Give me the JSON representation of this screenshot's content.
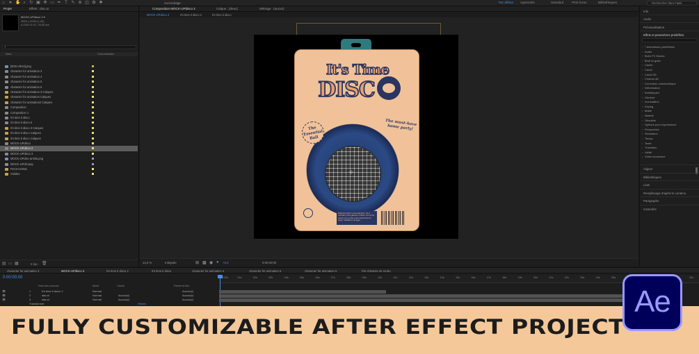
{
  "topbar": {
    "snap_label": "Accrochage",
    "workspaces": [
      "Par défaut",
      "Apprendre",
      "Standard",
      "Petit écran",
      "Bibliothèques"
    ],
    "active_workspace": "Par défaut",
    "search_placeholder": "Rechercher dans l'aide"
  },
  "project": {
    "tabs": [
      "Projet",
      "Effets : disc.ai"
    ],
    "selected_name": "MOCK-UPdisco 2 ▾",
    "info_lines": [
      "2000 x 2000 (1,00)",
      "Δ 0:00:11:01, 25,00 ips"
    ],
    "search_placeholder": "",
    "col_name": "Nom",
    "col_comment": "Commentaire",
    "items": [
      {
        "label": "[0001-0010].png",
        "type": "img",
        "color": "#c9b44a"
      },
      {
        "label": "character for animation 3",
        "type": "comp",
        "color": "#e8e07a"
      },
      {
        "label": "character for animation 4",
        "type": "comp",
        "color": "#e8e07a"
      },
      {
        "label": "character for animation 5",
        "type": "comp",
        "color": "#e8e07a"
      },
      {
        "label": "character for animation 6",
        "type": "comp",
        "color": "#e8e07a"
      },
      {
        "label": "character for animation 3 Calques",
        "type": "folder",
        "color": "#e8e07a"
      },
      {
        "label": "character for animation Calques",
        "type": "folder",
        "color": "#e8e07a"
      },
      {
        "label": "character for animation2 Calques",
        "type": "folder",
        "color": "#e8e07a"
      },
      {
        "label": "Composition",
        "type": "comp",
        "color": "#e8e07a"
      },
      {
        "label": "Composition 1",
        "type": "comp",
        "color": "#e8e07a"
      },
      {
        "label": "it's time ti disco",
        "type": "comp",
        "color": "#e8e07a"
      },
      {
        "label": "it's time ti disco-2",
        "type": "comp",
        "color": "#e8e07a"
      },
      {
        "label": "it's time ti disco 3 Calques",
        "type": "folder",
        "color": "#e8e07a"
      },
      {
        "label": "it's time ti disco Calques",
        "type": "folder",
        "color": "#e8e07a"
      },
      {
        "label": "it's time ti disco Calques",
        "type": "folder",
        "color": "#e8e07a"
      },
      {
        "label": "MOCK-UPdisco",
        "type": "comp",
        "color": "#e8e07a"
      },
      {
        "label": "MOCK-UPdisco 2",
        "type": "comp",
        "color": "#e8e07a",
        "selected": true
      },
      {
        "label": "MOCK-UPdisco 3",
        "type": "comp",
        "color": "#e8e07a"
      },
      {
        "label": "MOCK-UPdisc-armila.png",
        "type": "img",
        "color": "#8f9ad8"
      },
      {
        "label": "MOCK-UPdsl.png",
        "type": "img",
        "color": "#8f9ad8"
      },
      {
        "label": "PACKAGING",
        "type": "folder",
        "color": "#e8e07a"
      },
      {
        "label": "Solides",
        "type": "folder",
        "color": "#e8e07a"
      }
    ],
    "footer_label": "8 bpc"
  },
  "composition": {
    "tabs": [
      "Composition MOCK-UPdisco 2",
      "Calque : (deux)",
      "Métrage : (aucun)"
    ],
    "breadcrumb": [
      "MOCK-UPdisco 3",
      "it's time ti disco 2",
      "it's time ti disco"
    ],
    "zoom": "12,5 %",
    "resolution": "Intégrale",
    "exposure": "+0,0",
    "timecode": "0:00:00:00"
  },
  "artwork": {
    "title1": "It's Time",
    "title2": "DISC",
    "badge": "The Essential Ball",
    "tagline": "The must-have home party!",
    "info_text": "Reflective light in every direction. It's a reminder of the glamour of disco. Put on the record, turn up the music and let the fun begin. Suitable for all ages."
  },
  "right_panel": {
    "sections_top": [
      "Info",
      "Audio",
      "Prévisualisation"
    ],
    "effects_header": "Effets et paramètres prédéfinis",
    "effects_search": "",
    "effects": [
      "* Animations prédéfinies",
      "Audio",
      "Boris FX Mocha",
      "Bruit et grain",
      "Cache",
      "Canal",
      "Canal 3D",
      "Cinema 4D",
      "Correction colorimétrique",
      "Déformation",
      "Esthétiques",
      "Générer",
      "Incrustation",
      "Keying",
      "Matte",
      "Netteté",
      "Obsolète",
      "Options pour expressions",
      "Perspective",
      "Simulation",
      "Temps",
      "Texte",
      "Transition",
      "Utilité",
      "Vidéo immersive"
    ],
    "sections_bottom": [
      "Aligner",
      "Bibliothèques",
      "Liam",
      "Remplissage d'après le contenu",
      "Paragraphe",
      "Caractère"
    ]
  },
  "timeline": {
    "tabs": [
      "character for animation 3",
      "MOCK-UPdisco 3",
      "it's time ti disco 2",
      "it's time ti disco",
      "character for animation 4",
      "character for animation 5",
      "character for animation 6",
      "File d'attente de rendu"
    ],
    "active_tab": "MOCK-UPdisco 3",
    "timecode": "0:00:00:00",
    "ticks": [
      "0:00s",
      "01s",
      "02s",
      "03s",
      "04s",
      "05s",
      "06s",
      "07s",
      "08s",
      "09s",
      "10s",
      "11s",
      "12s",
      "13s",
      "14s",
      "15s",
      "16s",
      "17s",
      "18s",
      "19s",
      "20s",
      "21s",
      "22s",
      "23s",
      "24s",
      "25s",
      "26s",
      "27s",
      "28s",
      "29s",
      "30s"
    ],
    "headers": {
      "name": "Nom des sources",
      "mode": "Mode",
      "cache": "Cache",
      "parent": "Parent et lien"
    },
    "layers": [
      {
        "num": "1",
        "name": "It's time ti disco 2",
        "mode": "Normal",
        "cache": "",
        "parent": "Aucun(e)"
      },
      {
        "num": "2",
        "name": "star.ai",
        "mode": "Normal",
        "cache": "Aucun(e)",
        "parent": "Aucun(e)"
      },
      {
        "num": "3",
        "name": "star.ai",
        "mode": "Normal",
        "cache": "Aucun(e)",
        "parent": "Aucun(e)"
      }
    ],
    "sub_label": "Transformer",
    "sub_value": "Rétabl."
  },
  "banner": {
    "text": "FULLY CUSTOMIZABLE AFTER EFFECT PROJECT",
    "logo_text": "Ae"
  }
}
